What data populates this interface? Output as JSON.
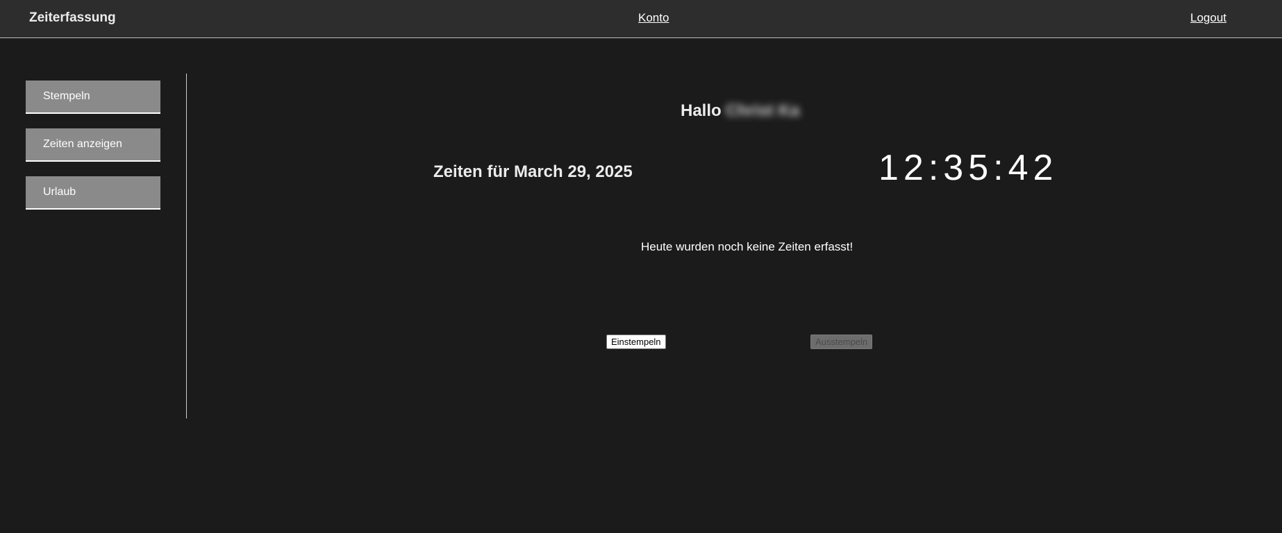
{
  "header": {
    "brand": "Zeiterfassung",
    "konto_link": "Konto",
    "logout_link": "Logout"
  },
  "sidebar": {
    "items": [
      {
        "label": "Stempeln"
      },
      {
        "label": "Zeiten anzeigen"
      },
      {
        "label": "Urlaub"
      }
    ]
  },
  "main": {
    "greeting_prefix": "Hallo",
    "user_name": "Christ Ka",
    "date_heading": "Zeiten für March 29, 2025",
    "clock": "12:35:42",
    "empty_message": "Heute wurden noch keine Zeiten erfasst!",
    "clock_in_label": "Einstempeln",
    "clock_out_label": "Ausstempeln"
  },
  "colors": {
    "background": "#1b1b1b",
    "header_bg": "#2d2d2d",
    "sidebar_item_bg": "#8a8a8a"
  }
}
